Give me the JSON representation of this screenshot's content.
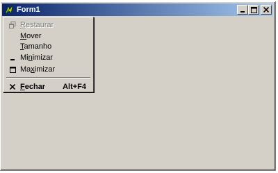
{
  "window": {
    "title": "Form1",
    "icon": "delphi-app-icon",
    "buttons": {
      "minimize": "minimize-icon",
      "maximize": "maximize-icon",
      "close": "close-icon"
    }
  },
  "system_menu": {
    "items": [
      {
        "label": "Restaurar",
        "underline_index": 0,
        "icon": "restore-icon",
        "enabled": false
      },
      {
        "label": "Mover",
        "underline_index": 0,
        "icon": "",
        "enabled": true
      },
      {
        "label": "Tamanho",
        "underline_index": 0,
        "icon": "",
        "enabled": true
      },
      {
        "label": "Minimizar",
        "underline_index": 2,
        "icon": "minimize-icon",
        "enabled": true
      },
      {
        "label": "Maximizar",
        "underline_index": 2,
        "icon": "maximize-icon",
        "enabled": true
      },
      {
        "label": "Fechar",
        "underline_index": 0,
        "icon": "close-icon",
        "enabled": true,
        "shortcut": "Alt+F4",
        "default": true
      }
    ]
  },
  "colors": {
    "face": "#d4d0c8",
    "title_start": "#0a246a",
    "title_end": "#a6caf0"
  }
}
